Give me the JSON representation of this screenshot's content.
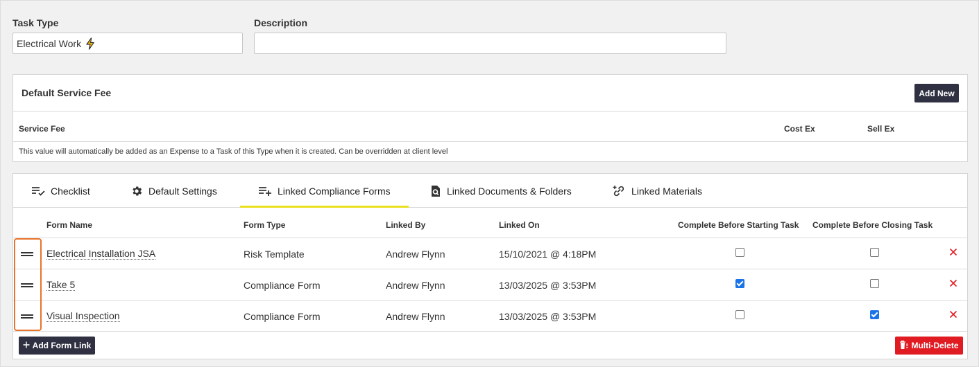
{
  "form": {
    "task_type_label": "Task Type",
    "task_type_value": "Electrical Work",
    "description_label": "Description",
    "description_value": ""
  },
  "service_fee": {
    "title": "Default Service Fee",
    "add_new_label": "Add New",
    "columns": [
      "Service Fee",
      "Cost Ex",
      "Sell Ex"
    ],
    "note": "This value will automatically be added as an Expense to a Task of this Type when it is created. Can be overridden at client level"
  },
  "tabs": [
    {
      "label": "Checklist",
      "icon": "checklist-icon",
      "active": false
    },
    {
      "label": "Default Settings",
      "icon": "gear-icon",
      "active": false
    },
    {
      "label": "Linked Compliance Forms",
      "icon": "list-add-icon",
      "active": true
    },
    {
      "label": "Linked Documents & Folders",
      "icon": "document-search-icon",
      "active": false
    },
    {
      "label": "Linked Materials",
      "icon": "link-add-icon",
      "active": false
    }
  ],
  "table": {
    "headers": [
      "Form Name",
      "Form Type",
      "Linked By",
      "Linked On",
      "Complete Before Starting Task",
      "Complete Before Closing Task"
    ],
    "rows": [
      {
        "form_name": "Electrical Installation JSA",
        "form_type": "Risk Template",
        "linked_by": "Andrew Flynn",
        "linked_on": "15/10/2021 @ 4:18PM",
        "before_start": false,
        "before_close": false
      },
      {
        "form_name": "Take 5",
        "form_type": "Compliance Form",
        "linked_by": "Andrew Flynn",
        "linked_on": "13/03/2025 @ 3:53PM",
        "before_start": true,
        "before_close": false
      },
      {
        "form_name": "Visual Inspection",
        "form_type": "Compliance Form",
        "linked_by": "Andrew Flynn",
        "linked_on": "13/03/2025 @ 3:53PM",
        "before_start": false,
        "before_close": true
      }
    ]
  },
  "footer": {
    "add_form_link_label": "Add Form Link",
    "multi_delete_label": "Multi-Delete"
  },
  "colors": {
    "accent_tab": "#e8e01e",
    "dark_button": "#2f3142",
    "danger": "#e11b22",
    "checkbox_checked": "#1a73e8",
    "highlight": "#e8732a"
  }
}
